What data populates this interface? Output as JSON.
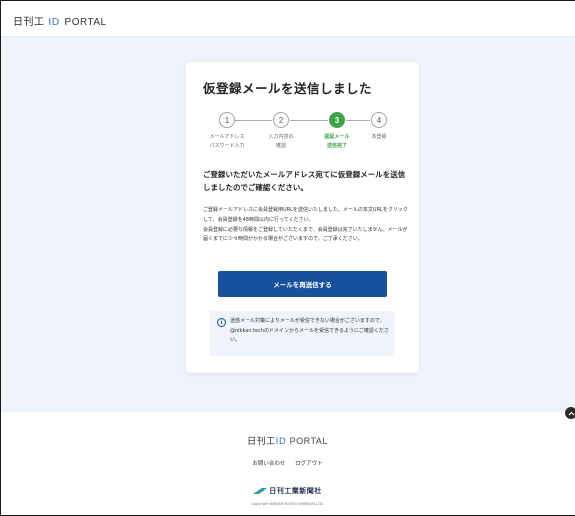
{
  "header": {
    "logo_prefix": "日刊工",
    "logo_id": "ID",
    "logo_suffix": "PORTAL"
  },
  "card": {
    "title": "仮登録メールを送信しました",
    "steps": [
      {
        "number": "1",
        "label_line1": "メールアドレス",
        "label_line2": "パスワード入力",
        "active": false
      },
      {
        "number": "2",
        "label_line1": "入力内容の",
        "label_line2": "確認",
        "active": false
      },
      {
        "number": "3",
        "label_line1": "認証メール",
        "label_line2": "送信完了",
        "active": true
      },
      {
        "number": "4",
        "label_line1": "本登録",
        "label_line2": "",
        "active": false
      }
    ],
    "lead": "ご登録いただいたメールアドレス宛てに仮登録メールを送信しましたのでご確認ください。",
    "body_line1": "ご登録メールアドレスに会員登録用URLを送信いたしました。メールの本文URLをクリックして、会員登録を48時間以内に行ってください。",
    "body_line2": "会員登録に必要な情報をご登録していただくまで、会員登録は完了いたしません。メールが届くまでに少々時間がかかる場合がございますので、ご了承ください。",
    "resend_button": "メールを再送信する",
    "info_icon": "info-circle-icon",
    "info_text": "迷惑メール対策によりメールが受信できない場合がございますので、@nikkan.techのドメインからメールを受信できるようにご確認ください。"
  },
  "footer": {
    "logo_prefix": "日刊工",
    "logo_id": "ID",
    "logo_suffix": "PORTAL",
    "links": [
      "お問い合わせ",
      "ログアウト"
    ],
    "brand": "日刊工業新聞社",
    "copyright": "Copyright NIKKAN KOGYO SHIMBUN,LTD."
  },
  "colors": {
    "accent": "#17509b",
    "step_active": "#3ea44a",
    "page_bg": "#eef4f9"
  }
}
